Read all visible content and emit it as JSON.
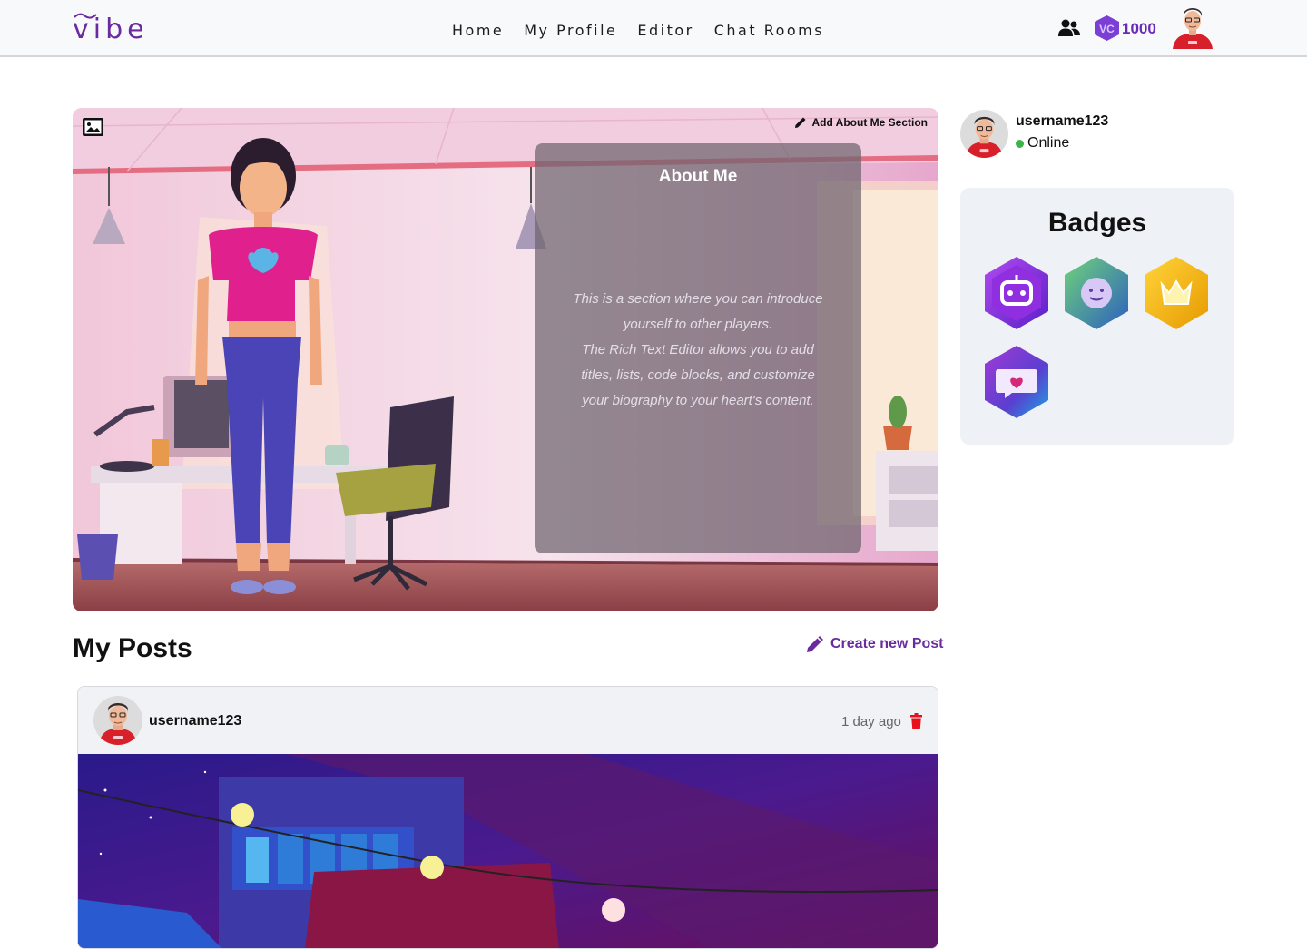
{
  "header": {
    "logo_text": "vibe",
    "nav": [
      "Home",
      "My Profile",
      "Editor",
      "Chat Rooms"
    ],
    "coins": "1000",
    "coin_label": "VC"
  },
  "banner": {
    "add_about_label": "Add About Me Section",
    "about_title": "About Me",
    "about_lines": [
      "This is a section where you can introduce",
      "yourself to other players.",
      "The Rich Text Editor allows you to add",
      "titles, lists, code blocks, and customize",
      "your biography to your heart's content."
    ]
  },
  "posts": {
    "title": "My Posts",
    "create_label": "Create new Post",
    "items": [
      {
        "username": "username123",
        "time": "1 day ago"
      }
    ]
  },
  "sidebar": {
    "username": "username123",
    "status": "Online",
    "badges_title": "Badges",
    "badges": [
      "robot-badge",
      "smiley-badge",
      "crown-badge",
      "chat-heart-badge"
    ]
  },
  "colors": {
    "brand": "#6a2aa0",
    "online": "#39b54a",
    "delete": "#e8101a"
  }
}
